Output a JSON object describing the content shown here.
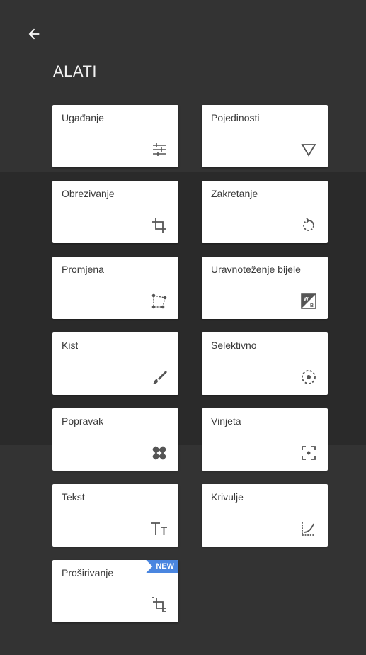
{
  "header": {
    "title": "ALATI"
  },
  "tools": [
    {
      "label": "Ugađanje",
      "icon": "adjust-sliders-icon"
    },
    {
      "label": "Pojedinosti",
      "icon": "details-triangle-icon"
    },
    {
      "label": "Obrezivanje",
      "icon": "crop-icon"
    },
    {
      "label": "Zakretanje",
      "icon": "rotate-icon"
    },
    {
      "label": "Promjena",
      "icon": "perspective-icon"
    },
    {
      "label": "Uravnoteženje bijele",
      "icon": "white-balance-icon"
    },
    {
      "label": "Kist",
      "icon": "brush-icon"
    },
    {
      "label": "Selektivno",
      "icon": "selective-icon"
    },
    {
      "label": "Popravak",
      "icon": "healing-bandage-icon"
    },
    {
      "label": "Vinjeta",
      "icon": "vignette-icon"
    },
    {
      "label": "Tekst",
      "icon": "text-icon"
    },
    {
      "label": "Krivulje",
      "icon": "curves-icon"
    },
    {
      "label": "Proširivanje",
      "icon": "expand-icon",
      "badge": "NEW"
    }
  ],
  "colors": {
    "badge": "#4a86e0",
    "background": "#333333",
    "tile": "#ffffff"
  }
}
